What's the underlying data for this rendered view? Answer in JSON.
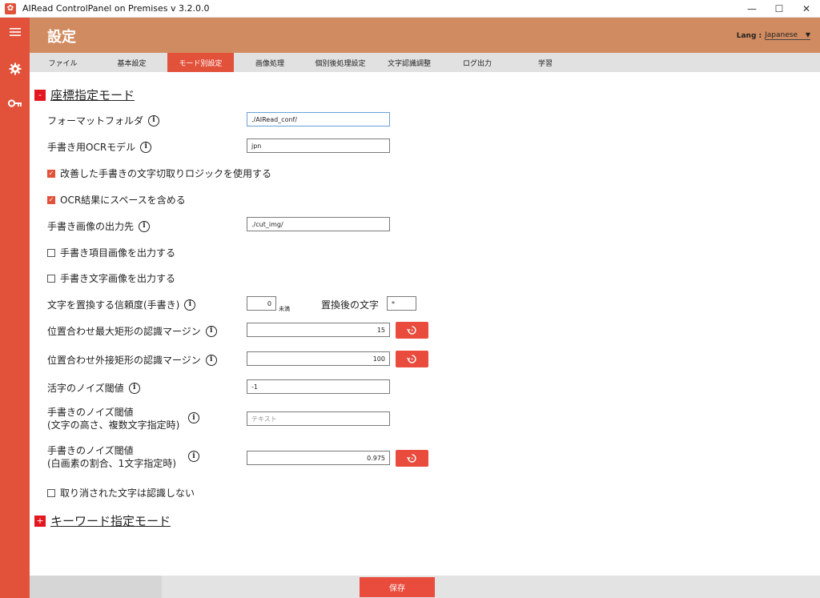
{
  "window": {
    "title": "AIRead ControlPanel on Premises v 3.2.0.0",
    "controls": {
      "minimize": "—",
      "maximize": "☐",
      "close": "✕"
    }
  },
  "sidebar": {
    "icons": [
      "menu-icon",
      "gear-icon",
      "key-icon"
    ]
  },
  "header": {
    "title": "設定",
    "lang_label": "Lang :",
    "lang_value": "Japanese"
  },
  "tabs": [
    {
      "label": "ファイル",
      "active": false
    },
    {
      "label": "基本設定",
      "active": false
    },
    {
      "label": "モード別設定",
      "active": true
    },
    {
      "label": "画像処理",
      "active": false
    },
    {
      "label": "個別後処理設定",
      "active": false
    },
    {
      "label": "文字認識調整",
      "active": false
    },
    {
      "label": "ログ出力",
      "active": false
    },
    {
      "label": "学習",
      "active": false
    }
  ],
  "section1": {
    "toggle": "-",
    "title": "座標指定モード",
    "format_folder": {
      "label": "フォーマットフォルダ",
      "value": "./AIRead_conf/"
    },
    "ocr_model": {
      "label": "手書き用OCRモデル",
      "value": "jpn"
    },
    "improved_cut": {
      "label": "改善した手書きの文字切取りロジックを使用する",
      "checked": true
    },
    "include_spaces": {
      "label": "OCR結果にスペースを含める",
      "checked": true
    },
    "output_dest": {
      "label": "手書き画像の出力先",
      "value": "./cut_img/"
    },
    "output_item_images": {
      "label": "手書き項目画像を出力する",
      "checked": false
    },
    "output_char_images": {
      "label": "手書き文字画像を出力する",
      "checked": false
    },
    "replace_confidence": {
      "label": "文字を置換する信頼度(手書き)",
      "value": "0",
      "suffix": "未満",
      "after_label": "置換後の文字",
      "after_value": "*"
    },
    "max_rect_margin": {
      "label": "位置合わせ最大矩形の認識マージン",
      "value": "15"
    },
    "outer_rect_margin": {
      "label": "位置合わせ外接矩形の認識マージン",
      "value": "100"
    },
    "print_noise": {
      "label": "活字のノイズ閾値",
      "value": "-1"
    },
    "hand_noise_height": {
      "label_line1": "手書きのノイズ閾値",
      "label_line2": "(文字の高さ、複数文字指定時)",
      "placeholder": "テキスト"
    },
    "hand_noise_white": {
      "label_line1": "手書きのノイズ閾値",
      "label_line2": "(白画素の割合、1文字指定時)",
      "value": "0.975"
    },
    "ignore_struck": {
      "label": "取り消された文字は認識しない",
      "checked": false
    }
  },
  "section2": {
    "toggle": "+",
    "title": "キーワード指定モード"
  },
  "footer": {
    "save_label": "保存"
  },
  "colors": {
    "accent": "#e2513a",
    "header": "#d18b60",
    "toggle": "#e4161f"
  }
}
